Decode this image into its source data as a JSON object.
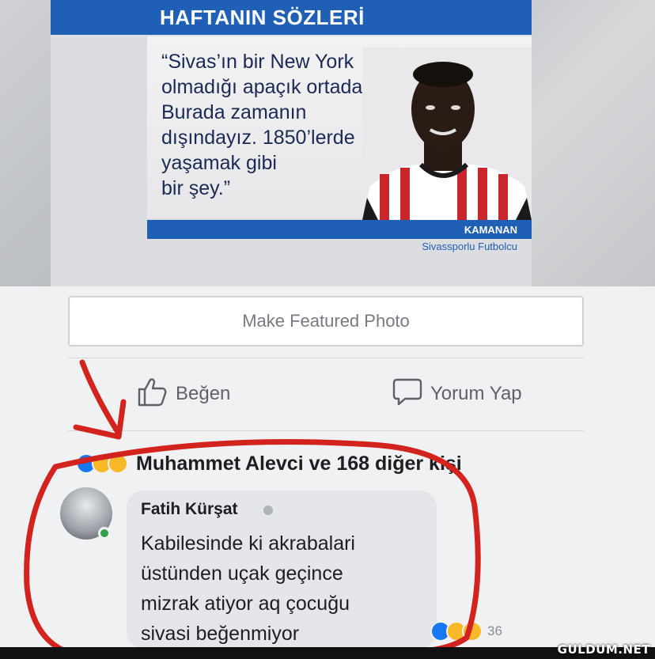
{
  "post": {
    "headline": "HAFTANIN SÖZLERİ",
    "quote": "“Sivas’ın bir New York\nolmadığı apaçık ortada.\nBurada zamanın\ndışındayız. 1850’lerde\nyaşamak gibi\nbir şey.”",
    "person_name": "KAMANAN",
    "person_role": "Sivassporlu Futbolcu"
  },
  "feature_button": {
    "label": "Make Featured Photo"
  },
  "actions": {
    "like_label": "Beğen",
    "comment_label": "Yorum Yap"
  },
  "reactions": {
    "summary": "Muhammet Alevci ve 168 diğer kişi",
    "types": [
      "like-icon",
      "haha-icon",
      "wow-icon"
    ]
  },
  "comment": {
    "author": "Fatih Kürşat",
    "text": "Kabilesinde ki akrabalari\nüstünden uçak geçince\nmizrak atiyor aq çocuğu\nsivasi beğenmiyor",
    "reaction_count": "36",
    "reaction_types": [
      "like-icon",
      "haha-icon",
      "wow-icon"
    ]
  },
  "watermark": "GULDUM.NET",
  "colors": {
    "brand_blue": "#1f5fb6",
    "annotation_red": "#d3231e",
    "like_blue": "#1877f2",
    "haha_yellow": "#f7b928",
    "online_green": "#31a24c"
  }
}
